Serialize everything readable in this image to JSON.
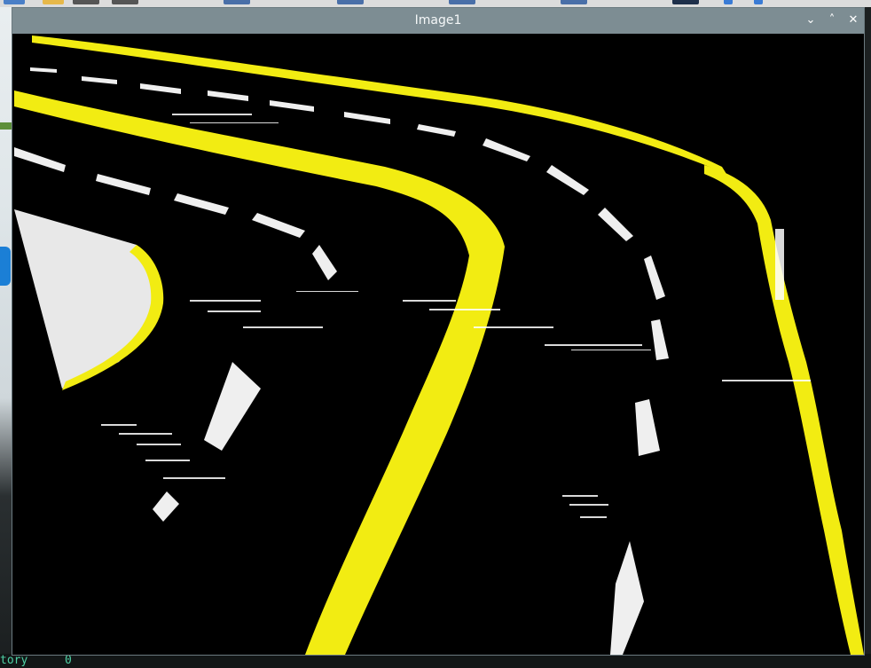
{
  "window": {
    "title": "Image1",
    "controls": {
      "minimize_icon": "chevron-down-icon",
      "maximize_icon": "chevron-up-icon",
      "close_icon": "close-icon",
      "minimize_glyph": "⌄",
      "maximize_glyph": "˄",
      "close_glyph": "✕"
    }
  },
  "image": {
    "description_colors": {
      "background": "#000000",
      "lane_yellow": "#f2ec12",
      "lane_white": "#f0f0f0"
    }
  },
  "background_terminal": {
    "text": "tory",
    "value": "0",
    "color": "#4fd1a5"
  },
  "colors": {
    "titlebar": "#7d8d93",
    "title_text": "#f4f7f8"
  }
}
